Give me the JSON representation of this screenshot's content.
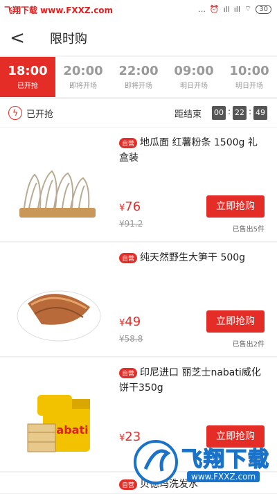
{
  "statusbar": {
    "watermark": "飞翔下载 www.FXXZ.com",
    "icons": [
      "alarm-icon",
      "signal-icon",
      "signal-icon",
      "wifi-icon"
    ],
    "signal_a": "...",
    "signal_b": "ıll",
    "signal_c": "ıll",
    "battery": "30"
  },
  "navbar": {
    "title": "限时购",
    "back_glyph": "<"
  },
  "tabs": [
    {
      "time": "18:00",
      "status": "已开抢",
      "active": true
    },
    {
      "time": "20:00",
      "status": "即将开场",
      "active": false
    },
    {
      "time": "22:00",
      "status": "即将开场",
      "active": false
    },
    {
      "time": "09:00",
      "status": "明日开场",
      "active": false
    },
    {
      "time": "10:00",
      "status": "明日开场",
      "active": false
    }
  ],
  "countdown": {
    "started_label": "已开抢",
    "end_label": "距结束",
    "hh": "00",
    "mm": "22",
    "ss": "49"
  },
  "products": [
    {
      "tag": "自营",
      "name": "地瓜面 红薯粉条 1500g 礼盒装",
      "price_symbol": "¥",
      "price": "76",
      "original": "¥91.2",
      "buy": "立即抢购",
      "sold": "已售出5件"
    },
    {
      "tag": "自营",
      "name": "纯天然野生大笋干 500g",
      "price_symbol": "¥",
      "price": "49",
      "original": "¥58.8",
      "buy": "立即抢购",
      "sold": "已售出2件"
    },
    {
      "tag": "自营",
      "name": "印尼进口 丽芝士nabati威化饼干350g",
      "price_symbol": "¥",
      "price": "23",
      "original": "",
      "buy": "立即抢购",
      "sold": ""
    },
    {
      "tag": "自营",
      "name": "贝德玛洗发水",
      "price_symbol": "",
      "price": "",
      "original": "",
      "buy": "",
      "sold": ""
    }
  ],
  "watermark": {
    "logo_text": "飞翔下载",
    "url": "www.FXXZ.com"
  },
  "colors": {
    "accent": "#e52d27",
    "countdown_box": "#555555"
  }
}
